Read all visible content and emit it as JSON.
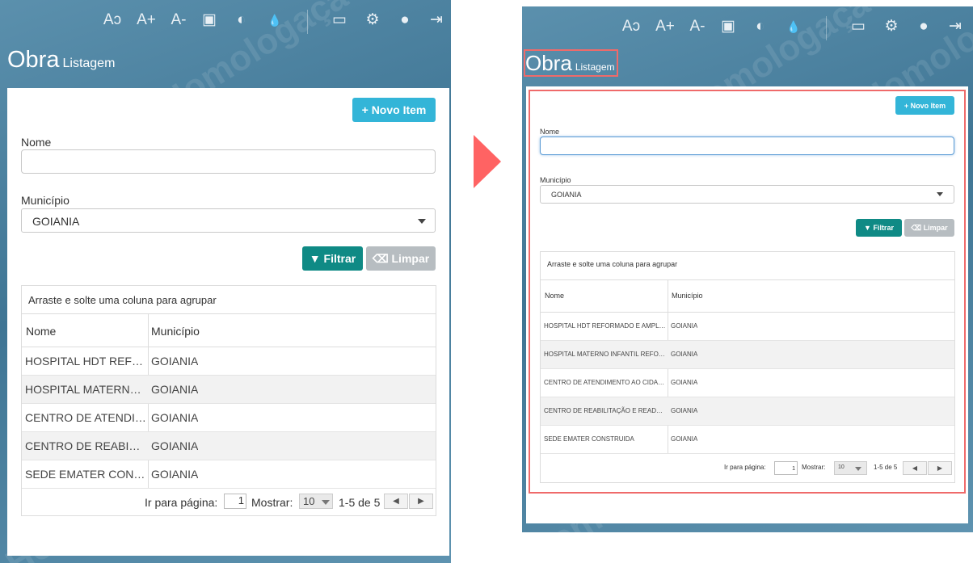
{
  "toolbar": {
    "font_reset_icon": "Aↄ",
    "font_increase_icon": "A+",
    "font_decrease_icon": "A-",
    "cube_icon": "▣",
    "contrast_icon": "◐",
    "drop_icon": "💧",
    "monitor_icon": "▭",
    "gear_icon": "⚙",
    "user_icon": "●",
    "logout_icon": "⇥"
  },
  "watermark": "Homologação",
  "page": {
    "title": "Obra",
    "subtitle": "Listagem"
  },
  "actions": {
    "new_item": "+ Novo Item"
  },
  "form": {
    "nome_label": "Nome",
    "nome_value": "",
    "municipio_label": "Município",
    "municipio_value": "GOIANIA",
    "filter_button": "▼ Filtrar",
    "clear_button": "⌫ Limpar"
  },
  "grid": {
    "group_hint": "Arraste e solte uma coluna para agrupar",
    "columns": [
      "Nome",
      "Município"
    ],
    "rows_short": [
      [
        "HOSPITAL HDT REFOR...",
        "GOIANIA"
      ],
      [
        "HOSPITAL MATERNO I...",
        "GOIANIA"
      ],
      [
        "CENTRO DE ATENDIME...",
        "GOIANIA"
      ],
      [
        "CENTRO DE REABILITA...",
        "GOIANIA"
      ],
      [
        "SEDE EMATER CONSTR...",
        "GOIANIA"
      ]
    ],
    "rows_long": [
      [
        "HOSPITAL HDT REFORMADO E AMPLIA...",
        "GOIANIA"
      ],
      [
        "HOSPITAL MATERNO INFANTIL REFOR...",
        "GOIANIA"
      ],
      [
        "CENTRO DE ATENDIMENTO AO CIDAD...",
        "GOIANIA"
      ],
      [
        "CENTRO DE REABILITAÇÃO E READAPT...",
        "GOIANIA"
      ],
      [
        "SEDE EMATER CONSTRUIDA",
        "GOIANIA"
      ]
    ]
  },
  "pager": {
    "goto_label": "Ir para página:",
    "page_value": "1",
    "show_label": "Mostrar:",
    "page_size": "10",
    "range": "1-5 de 5",
    "prev_icon": "◀",
    "next_icon": "▶"
  },
  "colors": {
    "arrow": "#ff6363",
    "highlight": "#ef6a6a",
    "primary": "#33b5d8",
    "filter": "#0f8a85"
  }
}
